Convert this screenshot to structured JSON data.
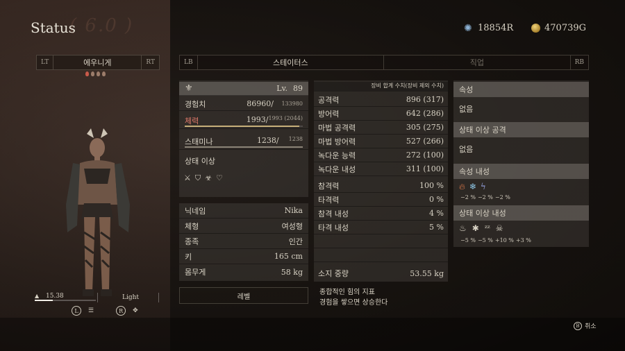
{
  "header": {
    "title": "Status",
    "watermark": "( 6.0 )",
    "rift_crystals": "18854R",
    "gold": "470739G"
  },
  "character": {
    "left_tag": "LT",
    "name": "에우니게",
    "right_tag": "RT",
    "weight_value": "15.38",
    "weight_fill_fraction": 0.3,
    "weight_class": "Light",
    "hint_l": "L",
    "hint_r": "R"
  },
  "tabs": {
    "left_tag": "LB",
    "active": "스테이터스",
    "inactive": "직업",
    "right_tag": "RB"
  },
  "basic": {
    "lv_label": "Lv.",
    "lv_value": "89",
    "exp_label": "경험치",
    "exp_value": "86960/",
    "exp_next": "133980",
    "hp_label": "체력",
    "hp_value": "1993/",
    "hp_max": "1993 (2044)",
    "hp_fill_fraction": 0.97,
    "stamina_label": "스태미나",
    "stamina_value": "1238/",
    "stamina_max": "1238",
    "stamina_fill_fraction": 1.0,
    "status_ailment_label": "상태 이상"
  },
  "profile": {
    "rows": [
      {
        "label": "닉네임",
        "value": "Nika"
      },
      {
        "label": "체형",
        "value": "여성형"
      },
      {
        "label": "종족",
        "value": "인간"
      },
      {
        "label": "키",
        "value": "165 cm"
      },
      {
        "label": "몸무게",
        "value": "58 kg"
      }
    ]
  },
  "combat": {
    "header": "장비 합계 수치(장비 제외 수치)",
    "rows": [
      {
        "label": "공격력",
        "value": "896 (317)"
      },
      {
        "label": "방어력",
        "value": "642 (286)"
      },
      {
        "label": "마법 공격력",
        "value": "305 (275)"
      },
      {
        "label": "마법 방어력",
        "value": "527 (266)"
      },
      {
        "label": "녹다운 능력",
        "value": "272 (100)"
      },
      {
        "label": "녹다운 내성",
        "value": "311 (100)"
      },
      {
        "label": "참격력",
        "value": "100 %"
      },
      {
        "label": "타격력",
        "value": "0 %"
      },
      {
        "label": "참격 내성",
        "value": "4 %"
      },
      {
        "label": "타격 내성",
        "value": "5 %"
      }
    ],
    "carry_label": "소지 중량",
    "carry_value": "53.55 kg"
  },
  "attributes": {
    "element_label": "속성",
    "element_value": "없음",
    "status_attack_label": "상태 이상 공격",
    "status_attack_value": "없음",
    "element_resist_label": "속성 내성",
    "element_resist_values": [
      "−2 %",
      "−2 %",
      "−2 %"
    ],
    "status_resist_label": "상태 이상 내성",
    "status_resist_values": [
      "−5 %",
      "−5 %",
      "+10 %",
      "+3 %"
    ]
  },
  "footer": {
    "level_button": "레벨",
    "desc_line1": "종합적인 힘의 지표",
    "desc_line2": "경험을 쌓으면 상승한다",
    "cancel_key": "B",
    "cancel_label": "취소"
  }
}
